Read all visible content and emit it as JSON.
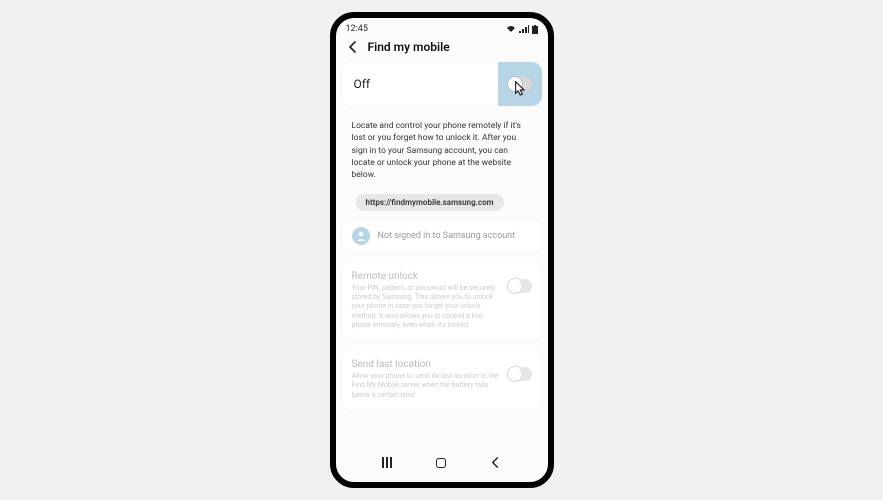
{
  "status": {
    "time": "12:45"
  },
  "header": {
    "title": "Find my mobile"
  },
  "main_toggle": {
    "label": "Off",
    "state": false
  },
  "description": "Locate and control your phone remotely if it's lost or you forget how to unlock it. After you sign in to your Samsung account, you can locate or unlock your phone at the website below.",
  "url": "https://findmymobile.samsung.com",
  "account": {
    "status": "Not signed in to Samsung account"
  },
  "settings": [
    {
      "title": "Remote unlock",
      "desc": "Your PIN, pattern, or password will be securely stored by Samsung. This allows you to unlock your phone in case you forget your unlock method. It also allows you to control a lost phone remotely, even when it's locked.",
      "enabled": false
    },
    {
      "title": "Send last location",
      "desc": "Allow your phone to send its last location to the Find My Mobile server when the battery falls below a certain level.",
      "enabled": false
    }
  ]
}
